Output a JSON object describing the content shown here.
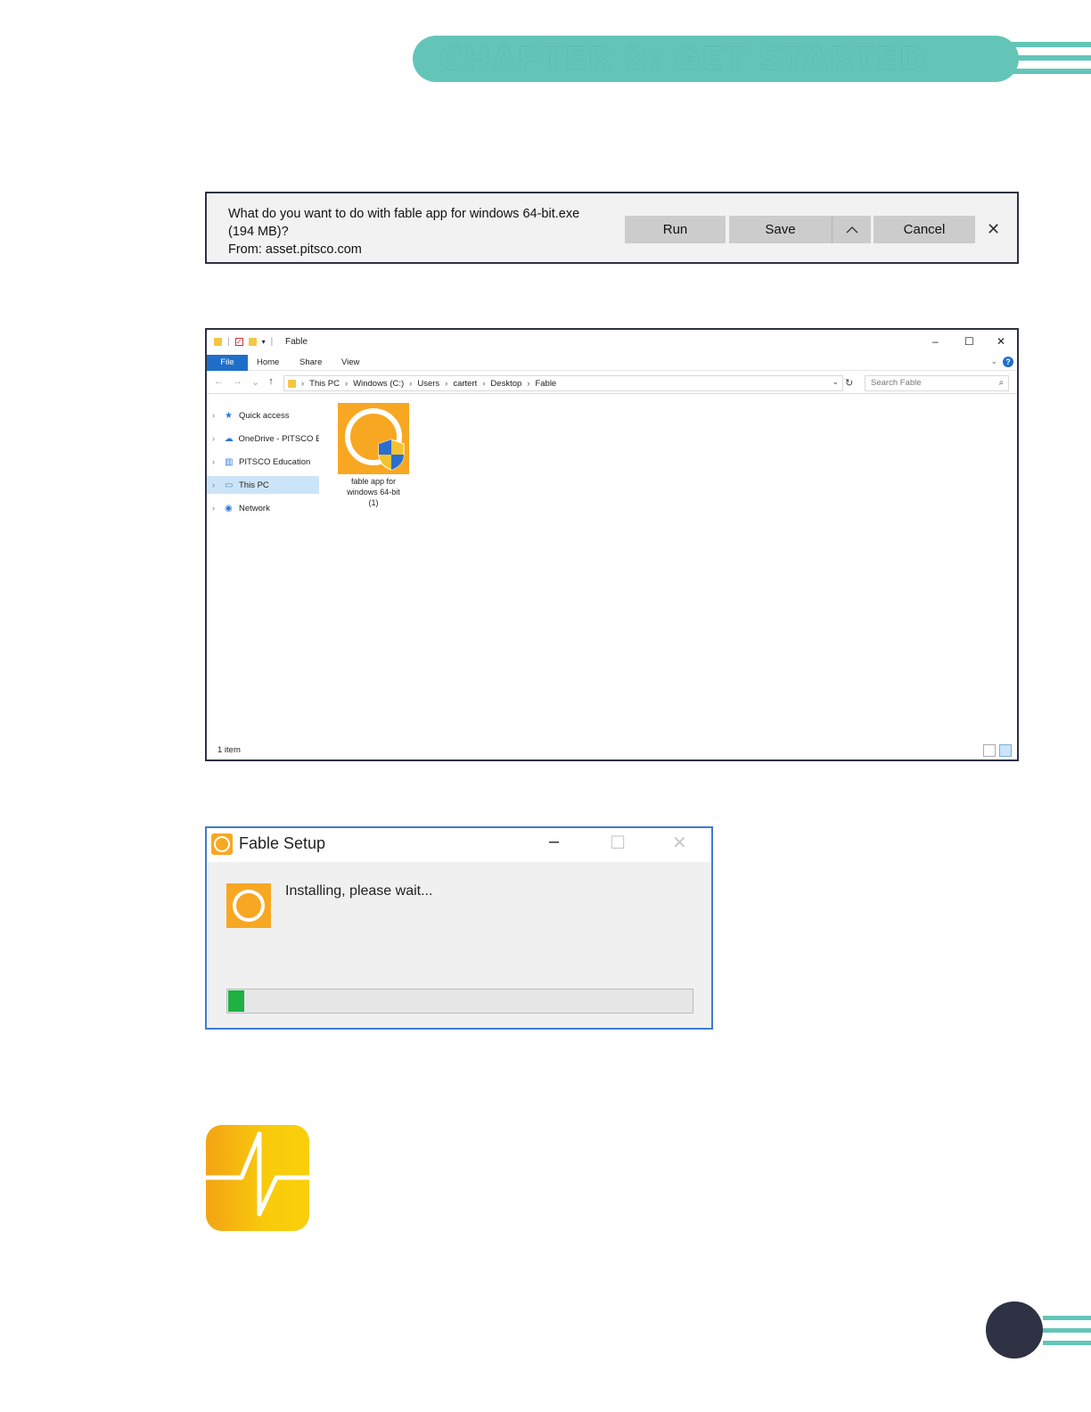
{
  "chapter": {
    "title": "CHAPTER 2: GET STARTED"
  },
  "download_bar": {
    "message_line1": "What do you want to do with fable app for windows 64-bit.exe",
    "message_line2": "(194 MB)?",
    "message_line3": "From: asset.pitsco.com",
    "run_label": "Run",
    "save_label": "Save",
    "cancel_label": "Cancel"
  },
  "explorer": {
    "window_title": "Fable",
    "ribbon_tabs": [
      "File",
      "Home",
      "Share",
      "View"
    ],
    "breadcrumb": [
      "This PC",
      "Windows (C:)",
      "Users",
      "cartert",
      "Desktop",
      "Fable"
    ],
    "search_placeholder": "Search Fable",
    "nav_items": [
      "Quick access",
      "OneDrive - PITSCO Ed",
      "PITSCO Education",
      "This PC",
      "Network"
    ],
    "selected_nav": "This PC",
    "file": {
      "label_line1": "fable app for",
      "label_line2": "windows 64-bit",
      "label_line3": "(1)"
    },
    "status": "1 item"
  },
  "setup": {
    "title": "Fable Setup",
    "message": "Installing, please wait...",
    "progress": 0.035,
    "progress_color": "#1fb141"
  },
  "colors": {
    "accent_teal": "#63c5b8",
    "navy": "#2f3144",
    "fable_orange": "#f8a722"
  }
}
